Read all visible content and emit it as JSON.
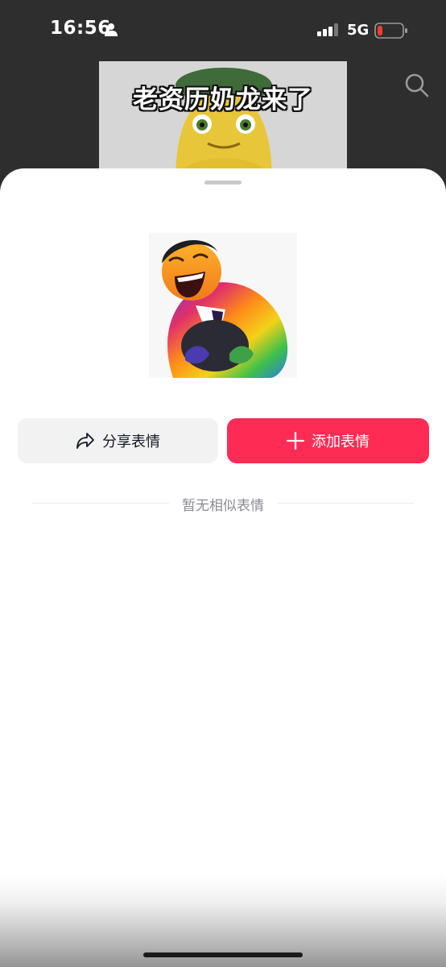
{
  "status_bar": {
    "time": "16:56",
    "network": "5G",
    "icons": [
      "person-icon",
      "signal-icon",
      "battery-low-icon"
    ],
    "battery_color": "#ff3b30"
  },
  "background": {
    "video_caption": "老资历奶龙来了",
    "search_icon": "search-icon"
  },
  "sheet": {
    "sticker_alt": "sticker-image",
    "share_button": {
      "icon": "share-arrow-icon",
      "label": "分享表情"
    },
    "add_button": {
      "icon": "plus-icon",
      "label": "添加表情"
    },
    "empty_text": "暂无相似表情"
  },
  "colors": {
    "accent": "#fe2c55",
    "share_bg": "#f2f2f3",
    "muted_text": "#8a8b91"
  }
}
